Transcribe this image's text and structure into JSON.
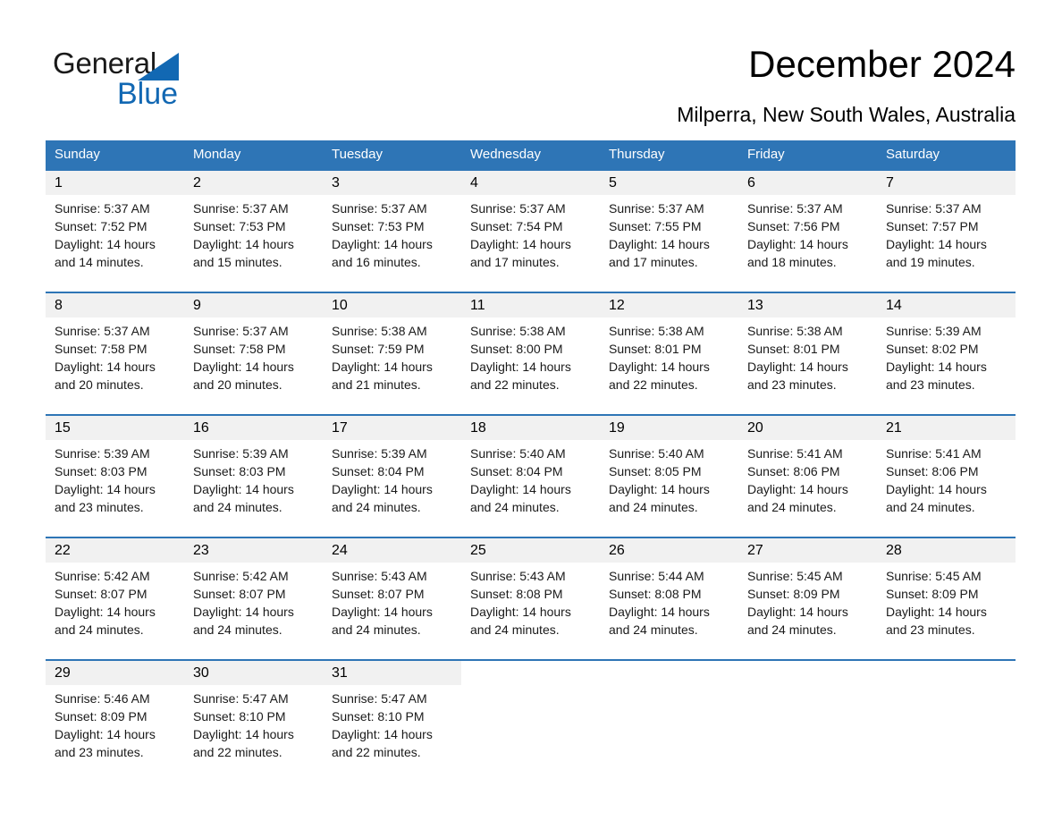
{
  "brand": {
    "name_part1": "General",
    "name_part2": "Blue",
    "accent_color": "#1268b3"
  },
  "header": {
    "title": "December 2024",
    "subtitle": "Milperra, New South Wales, Australia"
  },
  "theme": {
    "header_blue": "#2e75b6",
    "date_band_gray": "#f1f1f1"
  },
  "weekdays": [
    "Sunday",
    "Monday",
    "Tuesday",
    "Wednesday",
    "Thursday",
    "Friday",
    "Saturday"
  ],
  "weeks": [
    {
      "days": [
        {
          "date": "1",
          "sunrise": "Sunrise: 5:37 AM",
          "sunset": "Sunset: 7:52 PM",
          "daylight_line1": "Daylight: 14 hours",
          "daylight_line2": "and 14 minutes."
        },
        {
          "date": "2",
          "sunrise": "Sunrise: 5:37 AM",
          "sunset": "Sunset: 7:53 PM",
          "daylight_line1": "Daylight: 14 hours",
          "daylight_line2": "and 15 minutes."
        },
        {
          "date": "3",
          "sunrise": "Sunrise: 5:37 AM",
          "sunset": "Sunset: 7:53 PM",
          "daylight_line1": "Daylight: 14 hours",
          "daylight_line2": "and 16 minutes."
        },
        {
          "date": "4",
          "sunrise": "Sunrise: 5:37 AM",
          "sunset": "Sunset: 7:54 PM",
          "daylight_line1": "Daylight: 14 hours",
          "daylight_line2": "and 17 minutes."
        },
        {
          "date": "5",
          "sunrise": "Sunrise: 5:37 AM",
          "sunset": "Sunset: 7:55 PM",
          "daylight_line1": "Daylight: 14 hours",
          "daylight_line2": "and 17 minutes."
        },
        {
          "date": "6",
          "sunrise": "Sunrise: 5:37 AM",
          "sunset": "Sunset: 7:56 PM",
          "daylight_line1": "Daylight: 14 hours",
          "daylight_line2": "and 18 minutes."
        },
        {
          "date": "7",
          "sunrise": "Sunrise: 5:37 AM",
          "sunset": "Sunset: 7:57 PM",
          "daylight_line1": "Daylight: 14 hours",
          "daylight_line2": "and 19 minutes."
        }
      ]
    },
    {
      "days": [
        {
          "date": "8",
          "sunrise": "Sunrise: 5:37 AM",
          "sunset": "Sunset: 7:58 PM",
          "daylight_line1": "Daylight: 14 hours",
          "daylight_line2": "and 20 minutes."
        },
        {
          "date": "9",
          "sunrise": "Sunrise: 5:37 AM",
          "sunset": "Sunset: 7:58 PM",
          "daylight_line1": "Daylight: 14 hours",
          "daylight_line2": "and 20 minutes."
        },
        {
          "date": "10",
          "sunrise": "Sunrise: 5:38 AM",
          "sunset": "Sunset: 7:59 PM",
          "daylight_line1": "Daylight: 14 hours",
          "daylight_line2": "and 21 minutes."
        },
        {
          "date": "11",
          "sunrise": "Sunrise: 5:38 AM",
          "sunset": "Sunset: 8:00 PM",
          "daylight_line1": "Daylight: 14 hours",
          "daylight_line2": "and 22 minutes."
        },
        {
          "date": "12",
          "sunrise": "Sunrise: 5:38 AM",
          "sunset": "Sunset: 8:01 PM",
          "daylight_line1": "Daylight: 14 hours",
          "daylight_line2": "and 22 minutes."
        },
        {
          "date": "13",
          "sunrise": "Sunrise: 5:38 AM",
          "sunset": "Sunset: 8:01 PM",
          "daylight_line1": "Daylight: 14 hours",
          "daylight_line2": "and 23 minutes."
        },
        {
          "date": "14",
          "sunrise": "Sunrise: 5:39 AM",
          "sunset": "Sunset: 8:02 PM",
          "daylight_line1": "Daylight: 14 hours",
          "daylight_line2": "and 23 minutes."
        }
      ]
    },
    {
      "days": [
        {
          "date": "15",
          "sunrise": "Sunrise: 5:39 AM",
          "sunset": "Sunset: 8:03 PM",
          "daylight_line1": "Daylight: 14 hours",
          "daylight_line2": "and 23 minutes."
        },
        {
          "date": "16",
          "sunrise": "Sunrise: 5:39 AM",
          "sunset": "Sunset: 8:03 PM",
          "daylight_line1": "Daylight: 14 hours",
          "daylight_line2": "and 24 minutes."
        },
        {
          "date": "17",
          "sunrise": "Sunrise: 5:39 AM",
          "sunset": "Sunset: 8:04 PM",
          "daylight_line1": "Daylight: 14 hours",
          "daylight_line2": "and 24 minutes."
        },
        {
          "date": "18",
          "sunrise": "Sunrise: 5:40 AM",
          "sunset": "Sunset: 8:04 PM",
          "daylight_line1": "Daylight: 14 hours",
          "daylight_line2": "and 24 minutes."
        },
        {
          "date": "19",
          "sunrise": "Sunrise: 5:40 AM",
          "sunset": "Sunset: 8:05 PM",
          "daylight_line1": "Daylight: 14 hours",
          "daylight_line2": "and 24 minutes."
        },
        {
          "date": "20",
          "sunrise": "Sunrise: 5:41 AM",
          "sunset": "Sunset: 8:06 PM",
          "daylight_line1": "Daylight: 14 hours",
          "daylight_line2": "and 24 minutes."
        },
        {
          "date": "21",
          "sunrise": "Sunrise: 5:41 AM",
          "sunset": "Sunset: 8:06 PM",
          "daylight_line1": "Daylight: 14 hours",
          "daylight_line2": "and 24 minutes."
        }
      ]
    },
    {
      "days": [
        {
          "date": "22",
          "sunrise": "Sunrise: 5:42 AM",
          "sunset": "Sunset: 8:07 PM",
          "daylight_line1": "Daylight: 14 hours",
          "daylight_line2": "and 24 minutes."
        },
        {
          "date": "23",
          "sunrise": "Sunrise: 5:42 AM",
          "sunset": "Sunset: 8:07 PM",
          "daylight_line1": "Daylight: 14 hours",
          "daylight_line2": "and 24 minutes."
        },
        {
          "date": "24",
          "sunrise": "Sunrise: 5:43 AM",
          "sunset": "Sunset: 8:07 PM",
          "daylight_line1": "Daylight: 14 hours",
          "daylight_line2": "and 24 minutes."
        },
        {
          "date": "25",
          "sunrise": "Sunrise: 5:43 AM",
          "sunset": "Sunset: 8:08 PM",
          "daylight_line1": "Daylight: 14 hours",
          "daylight_line2": "and 24 minutes."
        },
        {
          "date": "26",
          "sunrise": "Sunrise: 5:44 AM",
          "sunset": "Sunset: 8:08 PM",
          "daylight_line1": "Daylight: 14 hours",
          "daylight_line2": "and 24 minutes."
        },
        {
          "date": "27",
          "sunrise": "Sunrise: 5:45 AM",
          "sunset": "Sunset: 8:09 PM",
          "daylight_line1": "Daylight: 14 hours",
          "daylight_line2": "and 24 minutes."
        },
        {
          "date": "28",
          "sunrise": "Sunrise: 5:45 AM",
          "sunset": "Sunset: 8:09 PM",
          "daylight_line1": "Daylight: 14 hours",
          "daylight_line2": "and 23 minutes."
        }
      ]
    },
    {
      "days": [
        {
          "date": "29",
          "sunrise": "Sunrise: 5:46 AM",
          "sunset": "Sunset: 8:09 PM",
          "daylight_line1": "Daylight: 14 hours",
          "daylight_line2": "and 23 minutes."
        },
        {
          "date": "30",
          "sunrise": "Sunrise: 5:47 AM",
          "sunset": "Sunset: 8:10 PM",
          "daylight_line1": "Daylight: 14 hours",
          "daylight_line2": "and 22 minutes."
        },
        {
          "date": "31",
          "sunrise": "Sunrise: 5:47 AM",
          "sunset": "Sunset: 8:10 PM",
          "daylight_line1": "Daylight: 14 hours",
          "daylight_line2": "and 22 minutes."
        },
        {
          "date": "",
          "sunrise": "",
          "sunset": "",
          "daylight_line1": "",
          "daylight_line2": ""
        },
        {
          "date": "",
          "sunrise": "",
          "sunset": "",
          "daylight_line1": "",
          "daylight_line2": ""
        },
        {
          "date": "",
          "sunrise": "",
          "sunset": "",
          "daylight_line1": "",
          "daylight_line2": ""
        },
        {
          "date": "",
          "sunrise": "",
          "sunset": "",
          "daylight_line1": "",
          "daylight_line2": ""
        }
      ]
    }
  ]
}
